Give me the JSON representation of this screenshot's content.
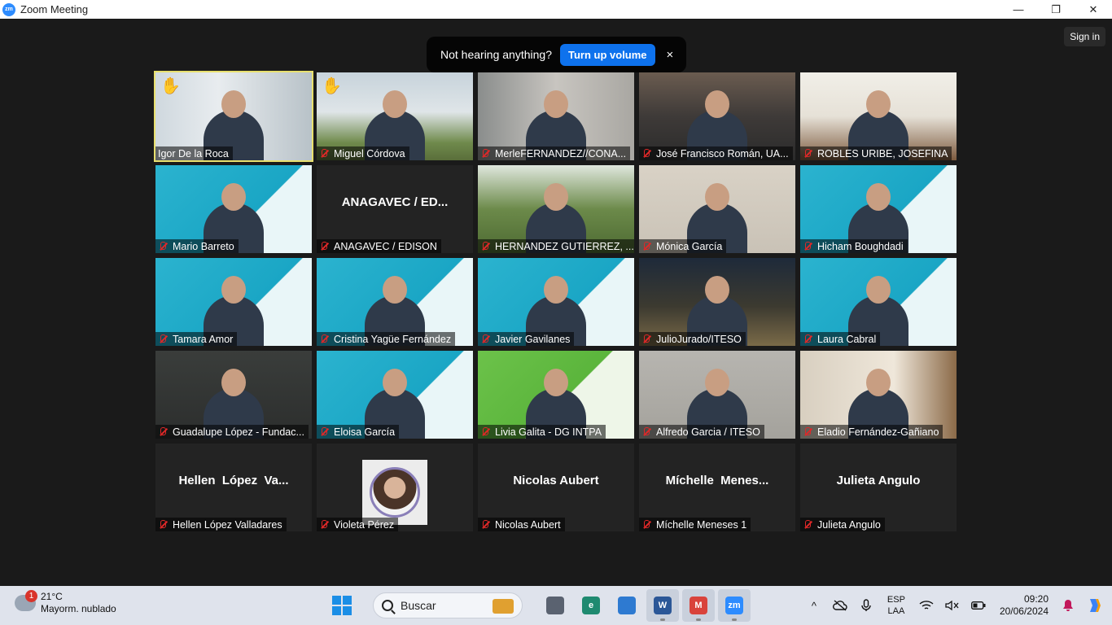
{
  "window": {
    "title": "Zoom Meeting",
    "logo": "zm",
    "controls": [
      "—",
      "❐",
      "✕"
    ]
  },
  "meeting": {
    "sign_in": "Sign in",
    "notice": {
      "text": "Not hearing anything?",
      "button": "Turn up volume",
      "close": "×"
    },
    "tiles": [
      {
        "name": "Igor De la Roca",
        "bg": "office",
        "hand": true,
        "active": true,
        "video": true
      },
      {
        "name": "Miguel Córdova",
        "bg": "garden",
        "hand": true,
        "muted": true,
        "video": true
      },
      {
        "name": "MerleFERNANDEZ//CONA...",
        "bg": "wall",
        "muted": true,
        "video": true
      },
      {
        "name": "José Francisco Román, UA...",
        "bg": "books",
        "muted": true,
        "video": true
      },
      {
        "name": "ROBLES URIBE, JOSEFINA",
        "bg": "room",
        "muted": true,
        "video": true
      },
      {
        "name": "Mario Barreto",
        "bg": "blue",
        "muted": true,
        "video": true
      },
      {
        "name": "ANAGAVEC / EDISON",
        "display": "ANAGAVEC / ED...",
        "muted": true,
        "video": false
      },
      {
        "name": "HERNANDEZ GUTIERREZ, ...",
        "bg": "trees",
        "muted": true,
        "video": true
      },
      {
        "name": "Mónica García",
        "bg": "beige",
        "muted": true,
        "video": true
      },
      {
        "name": "Hicham Boughdadi",
        "bg": "blue",
        "muted": true,
        "video": true
      },
      {
        "name": "Tamara Amor",
        "bg": "blue",
        "muted": true,
        "video": true
      },
      {
        "name": "Cristina Yagüe Fernández",
        "bg": "blue",
        "muted": true,
        "video": true
      },
      {
        "name": "Javier Gavilanes",
        "bg": "blue",
        "muted": true,
        "video": true
      },
      {
        "name": "JulioJurado/ITESO",
        "bg": "night",
        "muted": true,
        "video": true
      },
      {
        "name": "Laura Cabral",
        "bg": "blue",
        "muted": true,
        "video": true
      },
      {
        "name": "Guadalupe López - Fundac...",
        "bg": "dark",
        "muted": true,
        "video": true
      },
      {
        "name": "Eloisa García",
        "bg": "blue",
        "muted": true,
        "video": true
      },
      {
        "name": "Livia Galita - DG INTPA",
        "bg": "green",
        "muted": true,
        "video": true
      },
      {
        "name": "Alfredo Garcia / ITESO",
        "bg": "grey",
        "muted": true,
        "video": true
      },
      {
        "name": "Eladio Fernández-Gañiano",
        "bg": "shelf",
        "muted": true,
        "video": true
      },
      {
        "name": "Hellen López Valladares",
        "display": "Hellen  López  Va...",
        "muted": true,
        "video": false
      },
      {
        "name": "Violeta Pérez",
        "muted": true,
        "video": false,
        "avatar": true
      },
      {
        "name": "Nicolas Aubert",
        "display": "Nicolas Aubert",
        "muted": true,
        "video": false
      },
      {
        "name": "Míchelle Meneses 1",
        "display": "Míchelle  Menes...",
        "muted": true,
        "video": false
      },
      {
        "name": "Julieta Angulo",
        "display": "Julieta Angulo",
        "muted": true,
        "video": false
      }
    ]
  },
  "taskbar": {
    "weather": {
      "badge": "1",
      "temp": "21°C",
      "desc": "Mayorm. nublado"
    },
    "search_placeholder": "Buscar",
    "apps": [
      {
        "name": "task-view",
        "label": "",
        "color": "#5a6270"
      },
      {
        "name": "edge",
        "label": "e",
        "color": "#1f8a70"
      },
      {
        "name": "store",
        "label": "",
        "color": "#2e7ad1"
      },
      {
        "name": "word",
        "label": "W",
        "color": "#2b5797",
        "open": true
      },
      {
        "name": "chrome",
        "label": "M",
        "color": "#d9433b",
        "open": true
      },
      {
        "name": "zoom",
        "label": "zm",
        "color": "#2d8cff",
        "open": true
      }
    ],
    "tray": {
      "chevron": "^",
      "lang_top": "ESP",
      "lang_bottom": "LAA",
      "time": "09:20",
      "date": "20/06/2024"
    }
  }
}
